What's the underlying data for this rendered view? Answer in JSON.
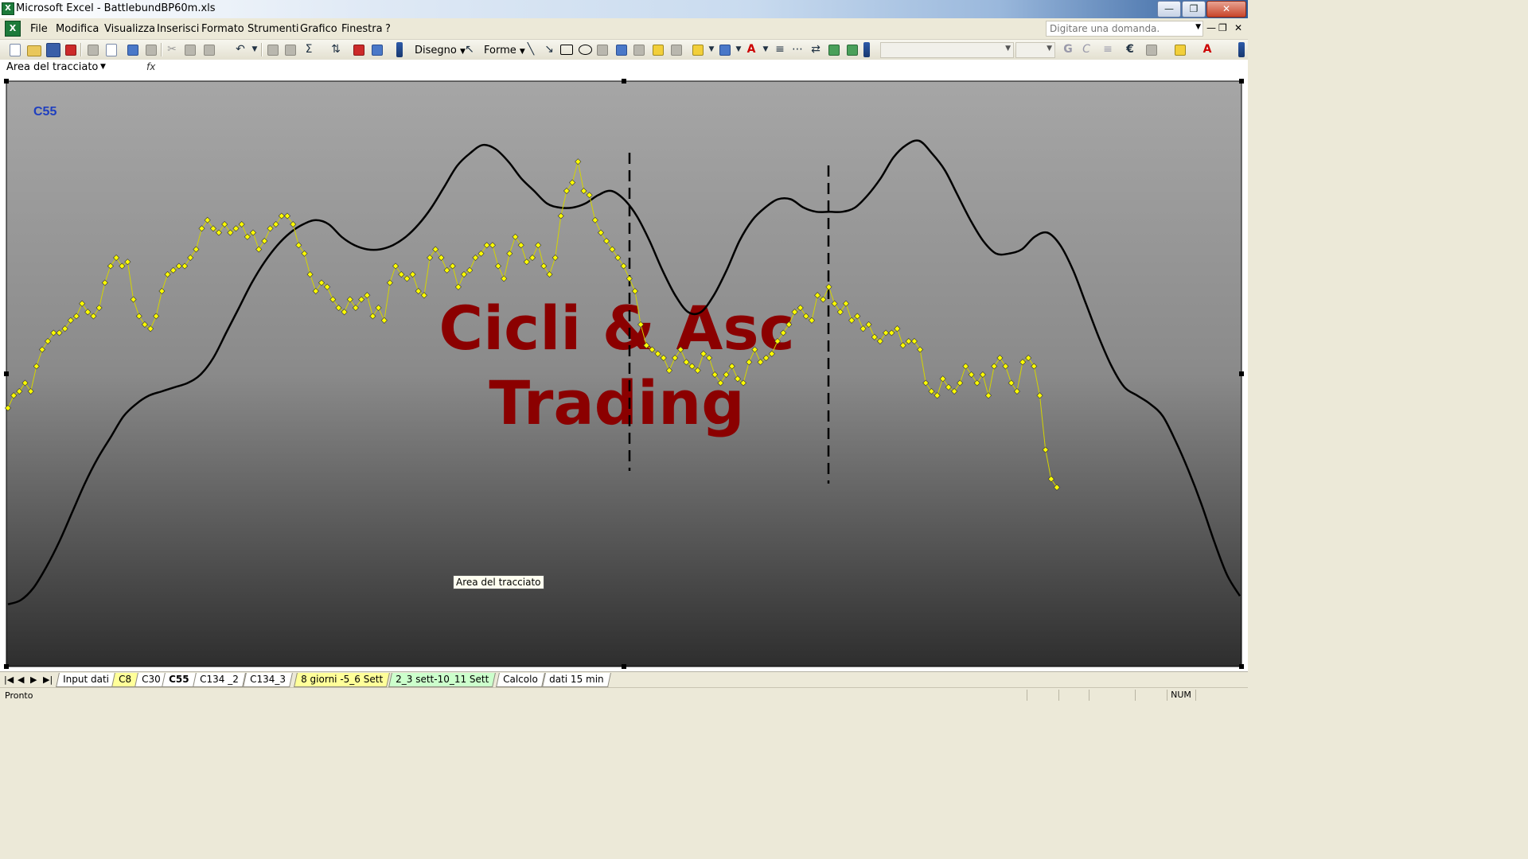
{
  "window": {
    "title": "Microsoft Excel - BattlebundBP60m.xls",
    "app_icon": "excel-icon",
    "minimize": "minimize-icon",
    "restore": "restore-icon",
    "close": "close-icon"
  },
  "menubar": {
    "items": [
      "File",
      "Modifica",
      "Visualizza",
      "Inserisci",
      "Formato",
      "Strumenti",
      "Grafico",
      "Finestra",
      "?"
    ],
    "ask_placeholder": "Digitare una domanda."
  },
  "toolbar": {
    "disegno_label": "Disegno",
    "forme_label": "Forme"
  },
  "formula": {
    "namebox": "Area del tracciato",
    "fx_icon": "fx-icon"
  },
  "chart": {
    "label": "C55",
    "watermark_line1": "Cicli & Asc",
    "watermark_line2": "Trading",
    "tooltip": "Area del tracciato",
    "colors": {
      "price_marker": "#ffff00",
      "price_line": "#d4d400",
      "cycle_line": "#000000",
      "watermark": "#8b0000",
      "label": "#1f3fbf",
      "bg_top": "#a8a8a8",
      "bg_bottom": "#2f2f2f"
    }
  },
  "chart_data": {
    "type": "line",
    "series": [
      {
        "style": "yellow-diamond-markers",
        "values": [
          52,
          55,
          56,
          58,
          56,
          62,
          66,
          68,
          70,
          70,
          71,
          73,
          74,
          77,
          75,
          74,
          76,
          82,
          86,
          88,
          86,
          87,
          78,
          74,
          72,
          71,
          74,
          80,
          84,
          85,
          86,
          86,
          88,
          90,
          95,
          97,
          95,
          94,
          96,
          94,
          95,
          96,
          93,
          94,
          90,
          92,
          95,
          96,
          98,
          98,
          96,
          91,
          89,
          84,
          80,
          82,
          81,
          78,
          76,
          75,
          78,
          76,
          78,
          79,
          74,
          76,
          73,
          82,
          86,
          84,
          83,
          84,
          80,
          79,
          88,
          90,
          88,
          85,
          86,
          81,
          84,
          85,
          88,
          89,
          91,
          91,
          86,
          83,
          89,
          93,
          91,
          87,
          88,
          91,
          86,
          84,
          88,
          98,
          104,
          106,
          111,
          104,
          103,
          97,
          94,
          92,
          90,
          88,
          86,
          83,
          80,
          72,
          67,
          66,
          65,
          64,
          61,
          64,
          66,
          63,
          62,
          61,
          65,
          64,
          60,
          58,
          60,
          62,
          59,
          58,
          63,
          66,
          63,
          64,
          65,
          68,
          70,
          72,
          75,
          76,
          74,
          73,
          79,
          78,
          81,
          77,
          75,
          77,
          73,
          74,
          71,
          72,
          69,
          68,
          70,
          70,
          71,
          67,
          68,
          68,
          66,
          58,
          56,
          55,
          59,
          57,
          56,
          58,
          62,
          60,
          58,
          60,
          55,
          62,
          64,
          62,
          58,
          56,
          63,
          64,
          62,
          55,
          42,
          35,
          33
        ]
      },
      {
        "style": "black-smooth-line",
        "values": [
          5,
          6,
          9,
          14,
          20,
          27,
          34,
          40,
          45,
          50,
          53,
          55,
          56,
          57,
          58,
          60,
          64,
          70,
          76,
          82,
          87,
          91,
          94,
          96,
          97,
          96,
          93,
          91,
          90,
          90,
          91,
          93,
          96,
          100,
          105,
          110,
          113,
          115,
          114,
          111,
          107,
          104,
          101,
          100,
          100,
          101,
          103,
          104,
          102,
          98,
          92,
          85,
          79,
          75,
          75,
          79,
          85,
          92,
          97,
          100,
          102,
          102,
          100,
          99,
          99,
          99,
          100,
          103,
          107,
          112,
          115,
          116,
          113,
          109,
          103,
          97,
          92,
          89,
          89,
          90,
          93,
          94,
          91,
          85,
          77,
          69,
          62,
          57,
          55,
          53,
          50,
          44,
          37,
          29,
          20,
          12,
          7
        ]
      }
    ],
    "vertical_markers": [
      "dashed-1",
      "dashed-2"
    ]
  },
  "sheets": {
    "tabs": [
      "Input dati",
      "C8",
      "C30",
      "C55",
      "C134 _2",
      "C134_3",
      "8 giorni -5_6 Sett",
      "2_3 sett-10_11 Sett",
      "Calcolo",
      "dati 15 min"
    ],
    "active": "C55"
  },
  "status": {
    "text": "Pronto",
    "num": "NUM"
  }
}
